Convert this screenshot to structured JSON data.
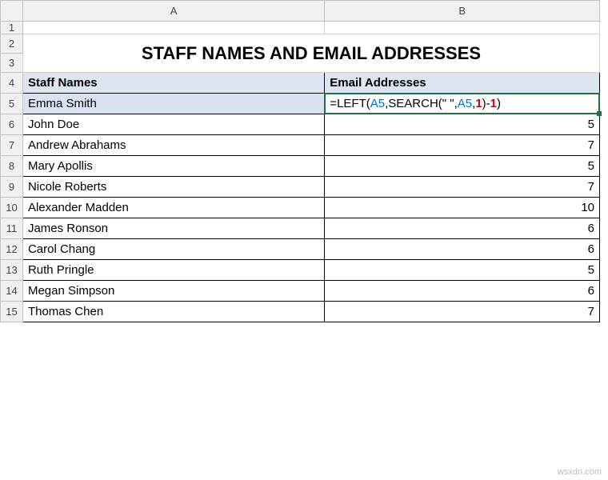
{
  "columns": {
    "A": "A",
    "B": "B"
  },
  "rows": [
    "1",
    "2",
    "3",
    "4",
    "5",
    "6",
    "7",
    "8",
    "9",
    "10",
    "11",
    "12",
    "13",
    "14",
    "15"
  ],
  "title": "STAFF NAMES AND EMAIL ADDRESSES",
  "headers": {
    "staff": "Staff Names",
    "email": "Email Addresses"
  },
  "formula": {
    "prefix": "=",
    "fn1": "LEFT(",
    "ref1": "A5",
    "comma1": ",",
    "fn2": "SEARCH(",
    "str": "\" \"",
    "comma2": ",",
    "ref2": "A5",
    "comma3": ",",
    "num1": "1",
    "close1": ")-",
    "num2": "1",
    "close2": ")"
  },
  "data": [
    {
      "name": "Emma Smith",
      "val": ""
    },
    {
      "name": "John Doe",
      "val": "5"
    },
    {
      "name": "Andrew Abrahams",
      "val": "7"
    },
    {
      "name": "Mary Apollis",
      "val": "5"
    },
    {
      "name": "Nicole Roberts",
      "val": "7"
    },
    {
      "name": "Alexander Madden",
      "val": "10"
    },
    {
      "name": "James Ronson",
      "val": "6"
    },
    {
      "name": "Carol Chang",
      "val": "6"
    },
    {
      "name": "Ruth Pringle",
      "val": "5"
    },
    {
      "name": "Megan Simpson",
      "val": "6"
    },
    {
      "name": "Thomas Chen",
      "val": "7"
    }
  ],
  "watermark": "wsxdn.com"
}
